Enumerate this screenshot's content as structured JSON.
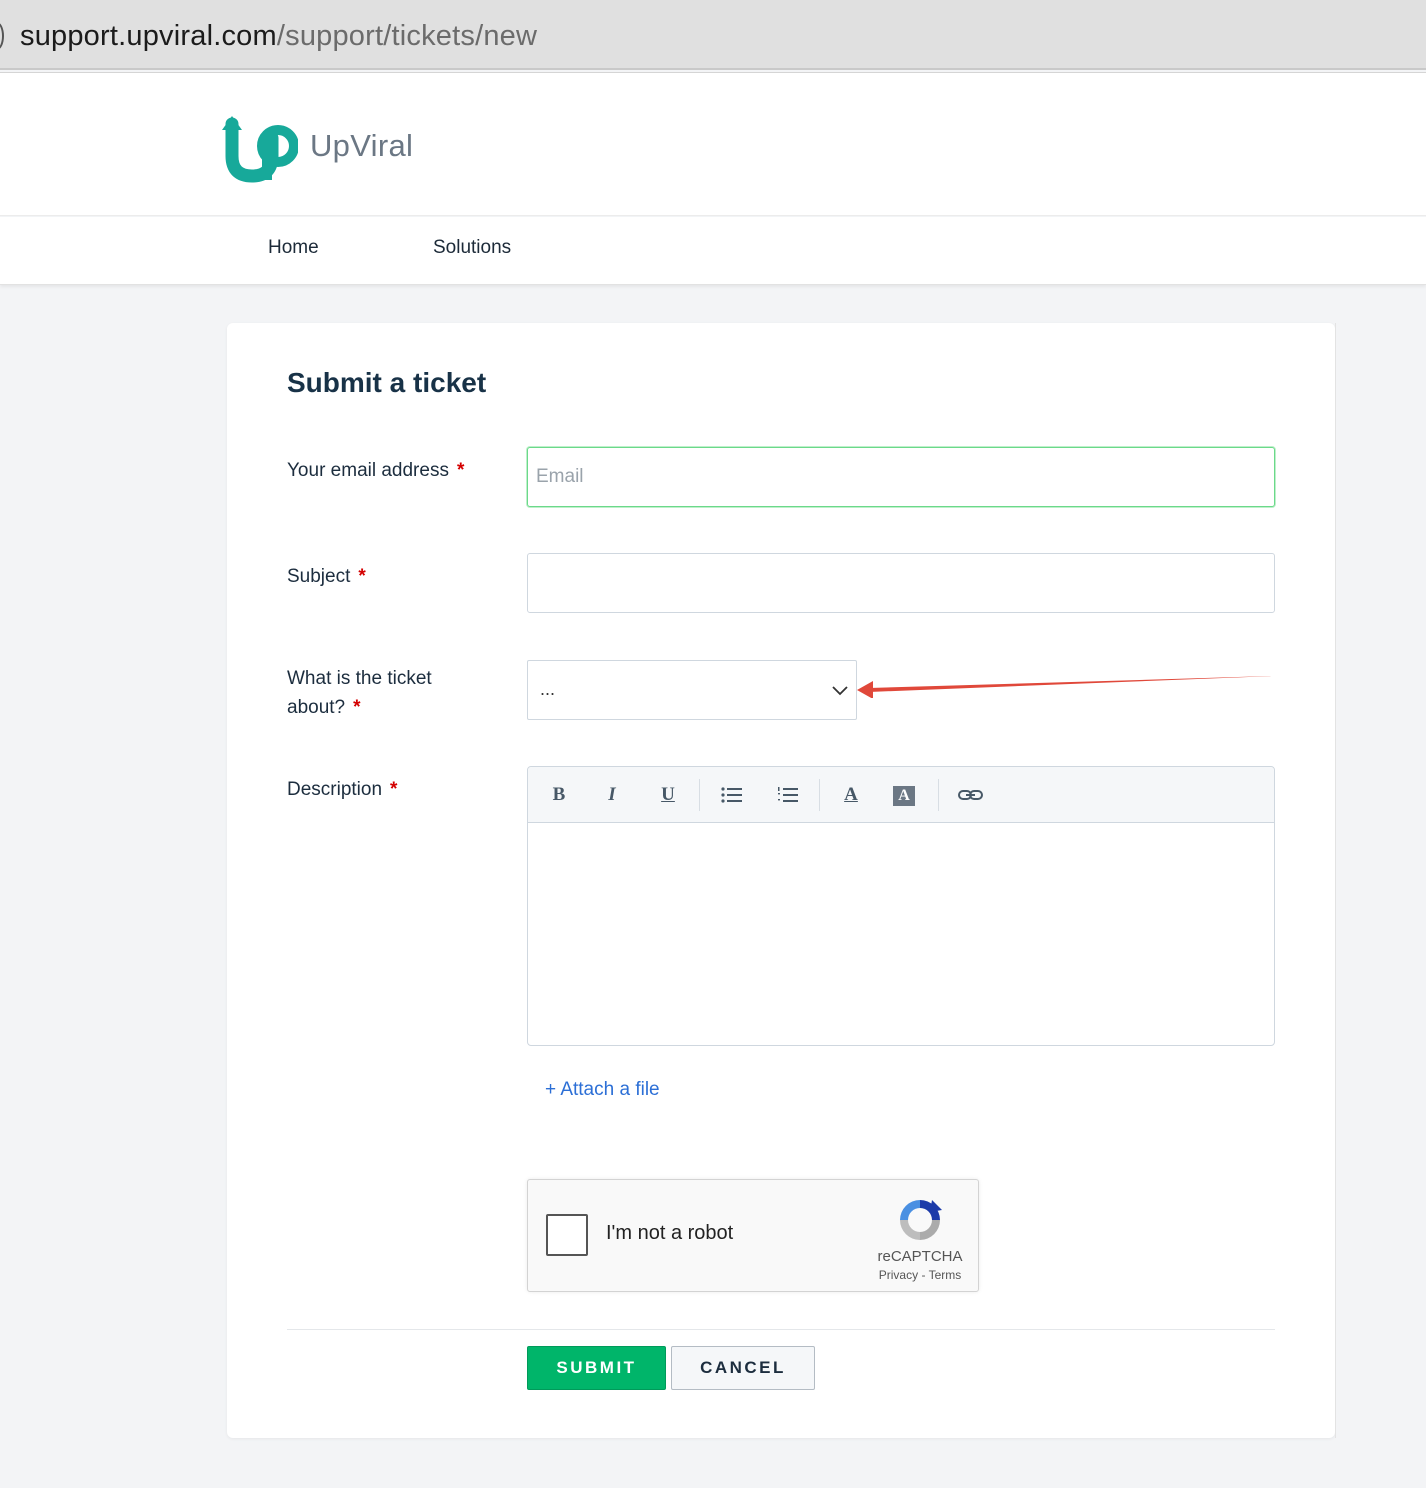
{
  "browser": {
    "url_host": "support.upviral.com",
    "url_path": "/support/tickets/new"
  },
  "header": {
    "brand": "UpViral",
    "nav": [
      "Home",
      "Solutions"
    ]
  },
  "form": {
    "title": "Submit a ticket",
    "required_mark": "*",
    "email": {
      "label": "Your email address",
      "placeholder": "Email",
      "value": ""
    },
    "subject": {
      "label": "Subject",
      "value": ""
    },
    "topic": {
      "label_line1": "What is the ticket",
      "label_line2": "about?",
      "selected": "..."
    },
    "description": {
      "label": "Description",
      "toolbar": {
        "bold": "B",
        "italic": "I",
        "underline": "U",
        "font_color": "A",
        "bg_color": "A"
      }
    },
    "attach": "+ Attach a file",
    "captcha": {
      "label": "I'm not a robot",
      "brand": "reCAPTCHA",
      "privacy": "Privacy",
      "separator": " - ",
      "terms": "Terms"
    },
    "submit": "SUBMIT",
    "cancel": "CANCEL"
  },
  "colors": {
    "brand_teal": "#17a99a",
    "submit_green": "#00b56a",
    "annotation_red": "#e0483a",
    "required_red": "#d40000",
    "link_blue": "#2c6fd6"
  }
}
